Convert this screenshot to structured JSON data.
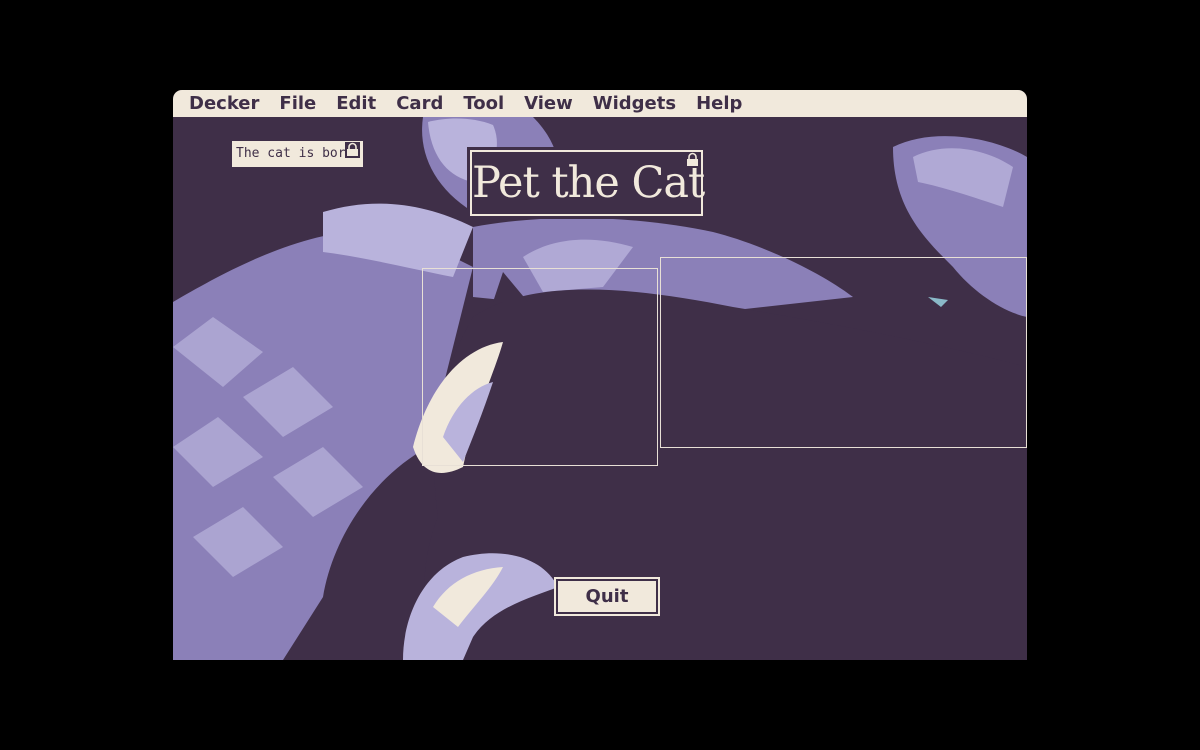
{
  "menubar": {
    "items": [
      "Decker",
      "File",
      "Edit",
      "Card",
      "Tool",
      "View",
      "Widgets",
      "Help"
    ]
  },
  "card": {
    "status_text": "The cat is bored.",
    "title": "Pet the Cat",
    "quit_label": "Quit"
  },
  "icons": {
    "status_lock": "lock-icon",
    "title_lock": "lock-icon"
  },
  "colors": {
    "background": "#3f2f48",
    "paper": "#f1e9dc",
    "lavender": "#8b80b8",
    "pale_lavender": "#b9b3dc",
    "desktop": "#000000"
  }
}
